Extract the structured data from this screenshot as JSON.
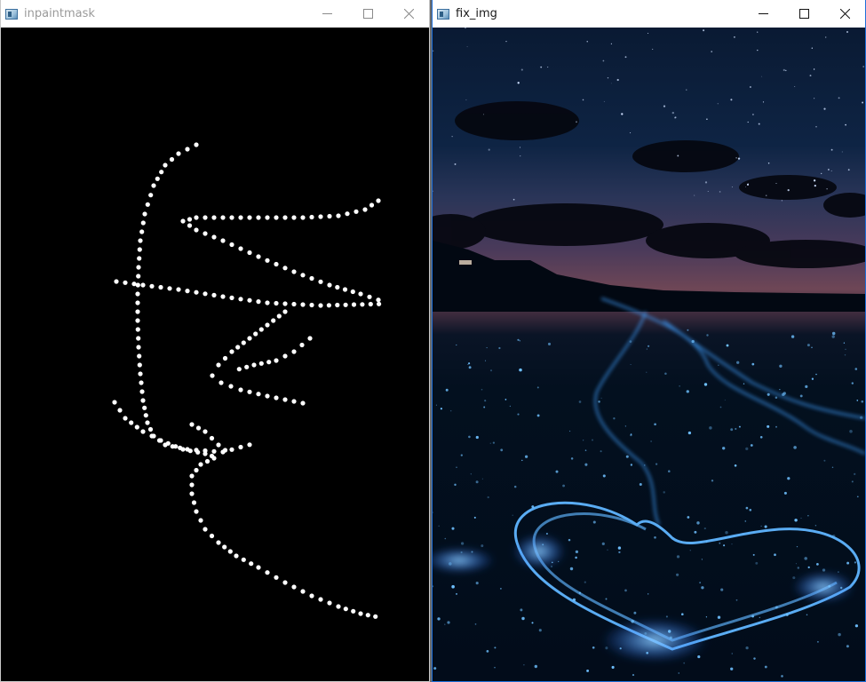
{
  "windows": {
    "left": {
      "title": "inpaintmask",
      "canvas_description": "mask"
    },
    "right": {
      "title": "fix_img"
    }
  },
  "controls": {
    "minimize_icon": "minimize-icon",
    "maximize_icon": "maximize-icon",
    "close_icon": "close-icon"
  },
  "colors": {
    "mask_background": "#000000",
    "mask_stroke": "#ffffff",
    "bioluminescent_blue": "#2f8cff",
    "active_border": "#1e6fd9"
  }
}
